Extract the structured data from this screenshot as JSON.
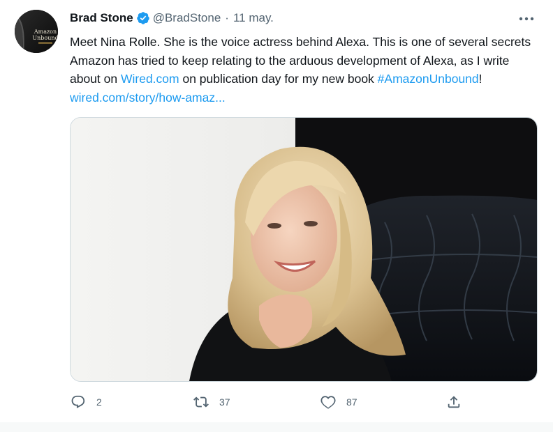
{
  "tweet": {
    "author_name": "Brad Stone",
    "handle": "@BradStone",
    "separator": "·",
    "date": "11 may.",
    "avatar_text_line1": "Amazon",
    "avatar_text_line2": "Unbound",
    "text_before_link": "Meet Nina Rolle. She is the voice actress behind Alexa. This is one of several secrets Amazon has tried to keep relating to the arduous development of Alexa, as I write about on ",
    "link1": "Wired.com",
    "text_after_link": " on publication day for my new book ",
    "hashtag": "#AmazonUnbound",
    "exclaim": "! ",
    "link2": "wired.com/story/how-amaz...",
    "replies": "2",
    "retweets": "37",
    "likes": "87"
  },
  "icons": {
    "verified": "verified-badge-icon",
    "more": "more-dots-icon",
    "reply": "reply-icon",
    "retweet": "retweet-icon",
    "like": "heart-icon",
    "share": "share-icon"
  },
  "colors": {
    "accent": "#1d9bf0",
    "text": "#0f1419",
    "muted": "#536471",
    "border": "#cfd9de"
  }
}
